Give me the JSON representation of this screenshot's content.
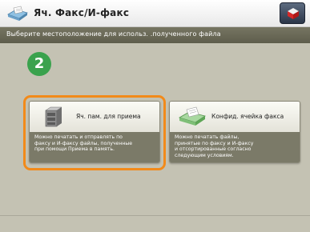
{
  "window": {
    "title": "Яч. Факс/И-факс",
    "title_icon": "fax-inbox-icon",
    "system_button_icon": "device-settings-icon"
  },
  "instruction": "Выберите местоположение для использ. .полученного файла",
  "step_badge": "2",
  "colors": {
    "step_badge": "#3aa24d",
    "highlight": "#f28a1a",
    "instruction_bar": "#6a6957"
  },
  "options": [
    {
      "label": "Яч. пам. для приема",
      "icon": "memory-box-icon",
      "description": "Можно печатать и отправлять по\nфаксу и И-факсу файлы, полученные\nпри помощи Приема в память."
    },
    {
      "label": "Конфид. ячейка факса",
      "icon": "fax-box-icon",
      "description": "Можно печатать файлы,\nпринятые по факсу и И-факсу\nи отсортированные согласно\nследующим условиям."
    }
  ]
}
